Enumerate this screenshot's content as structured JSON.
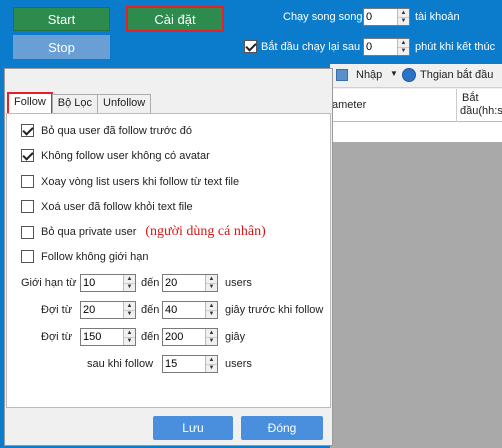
{
  "top": {
    "start_label": "Start",
    "settings_label": "Cài đặt",
    "stop_label": "Stop",
    "run_parallel_label": "Chạy song song",
    "run_parallel_value": "0",
    "accounts_label": "tài khoản",
    "restart_label": "Bắt đầu chạy lại sau",
    "restart_value": "0",
    "restart_suffix": "phút khi kết thúc",
    "restart_checked": true
  },
  "background_window": {
    "import_label": "Nhập",
    "start_time_label": "Thgian bắt đầu",
    "col_parameter": "ameter",
    "col_start": "Bắt",
    "col_start2": "đầu(hh:s"
  },
  "tabs": [
    "Follow",
    "Bộ Lọc",
    "Unfollow"
  ],
  "options": [
    {
      "label": "Bỏ qua user đã follow trước đó",
      "checked": true
    },
    {
      "label": "Không follow user không có avatar",
      "checked": true
    },
    {
      "label": "Xoay vòng list users khi follow từ text file",
      "checked": false
    },
    {
      "label": "Xoá user đã follow khỏi text file",
      "checked": false
    },
    {
      "label": "Bỏ qua private user",
      "checked": false,
      "annotation": "(người dùng cá nhân)"
    },
    {
      "label": "Follow không giới hạn",
      "checked": false
    }
  ],
  "limits": {
    "limit_from_label": "Giới hạn từ",
    "limit_from": "10",
    "to_label": "đến",
    "limit_to": "20",
    "users_label": "users",
    "wait_from_label": "Đợi từ",
    "wait_from": "20",
    "wait_to": "40",
    "wait_suffix": "giây trước khi follow",
    "wait2_from_label": "Đợi từ",
    "wait2_from": "150",
    "wait2_to": "200",
    "wait2_suffix": "giây",
    "after_follow_label": "sau khi follow",
    "after_follow_value": "15",
    "after_follow_suffix": "users"
  },
  "buttons": {
    "save_label": "Lưu",
    "close_label": "Đóng"
  },
  "colors": {
    "background": "#0a7ccb",
    "start_button": "#2e8b4e",
    "highlight_border": "#e8202a",
    "dialog_button": "#4a8fdd",
    "annotation": "#d01818"
  }
}
